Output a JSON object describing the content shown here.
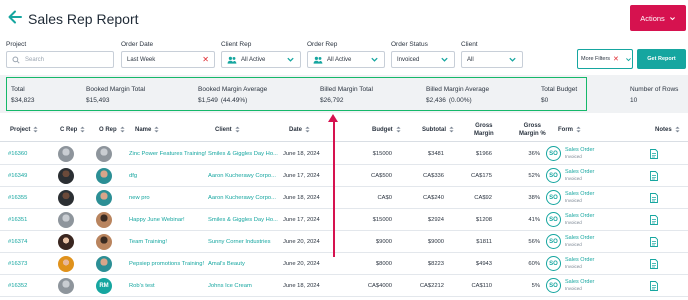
{
  "header": {
    "title": "Sales Rep Report",
    "actions_label": "Actions"
  },
  "filters": {
    "project": {
      "label": "Project",
      "placeholder": "Search"
    },
    "order_date": {
      "label": "Order Date",
      "value": "Last Week"
    },
    "client_rep": {
      "label": "Client Rep",
      "value": "All Active"
    },
    "order_rep": {
      "label": "Order Rep",
      "value": "All Active"
    },
    "order_status": {
      "label": "Order Status",
      "value": "Invoiced"
    },
    "client": {
      "label": "Client",
      "value": "All"
    },
    "more_filters_label": "More Filters",
    "get_report_label": "Get Report"
  },
  "summary": {
    "total": {
      "label": "Total",
      "value": "$34,823"
    },
    "booked_margin_total": {
      "label": "Booked Margin Total",
      "value": "$15,493"
    },
    "booked_margin_average": {
      "label": "Booked Margin Average",
      "value": "$1,549",
      "pct": "(44.49%)"
    },
    "billed_margin_total": {
      "label": "Billed Margin Total",
      "value": "$26,792"
    },
    "billed_margin_average": {
      "label": "Billed Margin Average",
      "value": "$2,436",
      "pct": "(0.00%)"
    },
    "total_budget": {
      "label": "Total Budget",
      "value": "$0"
    },
    "number_of_rows": {
      "label": "Number of Rows",
      "value": "10"
    }
  },
  "table": {
    "headers": {
      "project": "Project",
      "c_rep": "C Rep",
      "o_rep": "O Rep",
      "name": "Name",
      "client": "Client",
      "date": "Date",
      "budget": "Budget",
      "subtotal": "Subtotal",
      "gross_margin_l1": "Gross",
      "gross_margin_l2": "Margin",
      "gross_margin_pct_l1": "Gross",
      "gross_margin_pct_l2": "Margin %",
      "form": "Form",
      "notes": "Notes"
    },
    "rows": [
      {
        "project": "#16360",
        "c_avatar": "photo-grey",
        "o_avatar": "photo-grey",
        "name": "Zinc Power Features Training!",
        "client": "Smiles & Giggles Day Ho...",
        "date": "June 18, 2024",
        "budget": "$15000",
        "subtotal": "$3481",
        "gross_margin": "$1966",
        "gross_margin_pct": "36%",
        "form_badge": "SO",
        "form_title": "Sales Order",
        "form_status": "Invoiced"
      },
      {
        "project": "#16349",
        "c_avatar": "photo-dark",
        "o_avatar": "photo-teal",
        "name": "dfg",
        "client": "Aaron Kucherawy Corpo...",
        "date": "June 17, 2024",
        "budget": "CA$500",
        "subtotal": "CA$336",
        "gross_margin": "CA$175",
        "gross_margin_pct": "52%",
        "form_badge": "SO",
        "form_title": "Sales Order",
        "form_status": "Invoiced"
      },
      {
        "project": "#16355",
        "c_avatar": "photo-dark",
        "o_avatar": "photo-teal",
        "name": "new pro",
        "client": "Aaron Kucherawy Corpo...",
        "date": "June 18, 2024",
        "budget": "CA$0",
        "subtotal": "CA$240",
        "gross_margin": "CA$92",
        "gross_margin_pct": "38%",
        "form_badge": "SO",
        "form_title": "Sales Order",
        "form_status": "Invoiced"
      },
      {
        "project": "#16351",
        "c_avatar": "photo-grey",
        "o_avatar": "photo-brown",
        "name": "Happy June Webinar!",
        "client": "Smiles & Giggles Day Ho...",
        "date": "June 17, 2024",
        "budget": "$15000",
        "subtotal": "$2924",
        "gross_margin": "$1208",
        "gross_margin_pct": "41%",
        "form_badge": "SO",
        "form_title": "Sales Order",
        "form_status": "Invoiced"
      },
      {
        "project": "#16374",
        "c_avatar": "photo-woman",
        "o_avatar": "photo-brown",
        "name": "Team Training!",
        "client": "Sunny Corner Industries",
        "date": "June 20, 2024",
        "budget": "$9000",
        "subtotal": "$9000",
        "gross_margin": "$1811",
        "gross_margin_pct": "56%",
        "form_badge": "SO",
        "form_title": "Sales Order",
        "form_status": "Invoiced"
      },
      {
        "project": "#16373",
        "c_avatar": "photo-orange",
        "o_avatar": "photo-teal",
        "name": "Pepsiep promotions Training!",
        "client": "Amal's Beauty",
        "date": "June 20, 2024",
        "budget": "$8000",
        "subtotal": "$8223",
        "gross_margin": "$4943",
        "gross_margin_pct": "60%",
        "form_badge": "SO",
        "form_title": "Sales Order",
        "form_status": "Invoiced"
      },
      {
        "project": "#16352",
        "c_avatar": "photo-grey",
        "o_avatar": "initials",
        "o_initials": "RM",
        "name": "Rob's test",
        "client": "Johns Ice Cream",
        "date": "June 18, 2024",
        "budget": "CA$4000",
        "subtotal": "CA$2212",
        "gross_margin": "CA$110",
        "gross_margin_pct": "5%",
        "form_badge": "SO",
        "form_title": "Sales Order",
        "form_status": "Invoiced"
      }
    ]
  },
  "colors": {
    "accent_teal": "#16a6a0",
    "brand_pink": "#d6124f",
    "highlight_green": "#15b86a",
    "clear_red": "#e0282e"
  },
  "icons": {
    "back": "arrow-left-icon",
    "actions": "chevron-down-icon",
    "people": "people-icon",
    "clear": "close-icon",
    "sort": "sort-icon",
    "notes": "note-icon",
    "annotation": "arrow-up-icon"
  }
}
